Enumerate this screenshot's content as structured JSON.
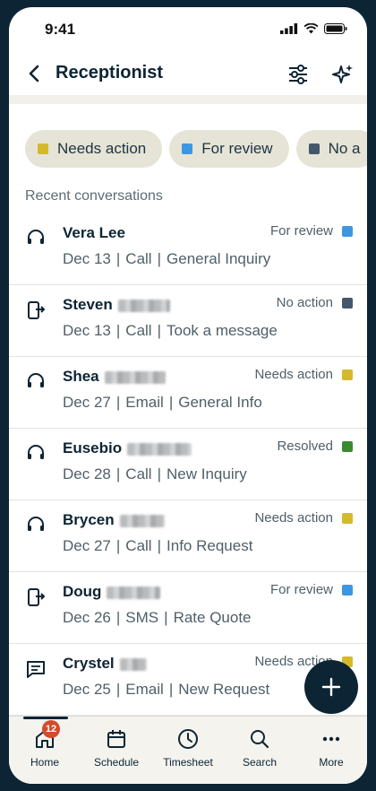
{
  "status_bar": {
    "time": "9:41"
  },
  "header": {
    "title": "Receptionist",
    "back_icon": "chevron-left-icon",
    "filter_icon": "sliders-icon",
    "ai_icon": "sparkles-icon"
  },
  "filters": [
    {
      "label": "Needs action",
      "color": "#d4b92c"
    },
    {
      "label": "For review",
      "color": "#3d96e0"
    },
    {
      "label": "No a",
      "color": "#45586a"
    }
  ],
  "section_title": "Recent conversations",
  "conversations": [
    {
      "name": "Vera Lee",
      "redacted": false,
      "date": "Dec 13",
      "channel": "Call",
      "topic": "General Inquiry",
      "status": "For review",
      "status_color": "#3d96e0",
      "icon": "headset-icon"
    },
    {
      "name": "Steven",
      "redacted": true,
      "date": "Dec 13",
      "channel": "Call",
      "topic": "Took a message",
      "status": "No action",
      "status_color": "#45586a",
      "icon": "phone-transfer-icon"
    },
    {
      "name": "Shea",
      "redacted": true,
      "date": "Dec 27",
      "channel": "Email",
      "topic": "General Info",
      "status": "Needs action",
      "status_color": "#d4b92c",
      "icon": "headset-icon"
    },
    {
      "name": "Eusebio",
      "redacted": true,
      "date": "Dec 28",
      "channel": "Call",
      "topic": "New Inquiry",
      "status": "Resolved",
      "status_color": "#3a8a32",
      "icon": "headset-icon"
    },
    {
      "name": "Brycen",
      "redacted": true,
      "date": "Dec 27",
      "channel": "Call",
      "topic": "Info Request",
      "status": "Needs action",
      "status_color": "#d4b92c",
      "icon": "headset-icon"
    },
    {
      "name": "Doug",
      "redacted": true,
      "date": "Dec 26",
      "channel": "SMS",
      "topic": "Rate Quote",
      "status": "For review",
      "status_color": "#3d96e0",
      "icon": "phone-transfer-icon"
    },
    {
      "name": "Crystel",
      "redacted": true,
      "date": "Dec 25",
      "channel": "Email",
      "topic": "New Request",
      "status": "Needs action",
      "status_color": "#d4b92c",
      "icon": "message-icon"
    }
  ],
  "fab": {
    "icon": "plus-icon"
  },
  "tabbar": {
    "tabs": [
      {
        "label": "Home",
        "icon": "home-icon",
        "badge": "12"
      },
      {
        "label": "Schedule",
        "icon": "calendar-icon"
      },
      {
        "label": "Timesheet",
        "icon": "clock-icon"
      },
      {
        "label": "Search",
        "icon": "search-icon"
      },
      {
        "label": "More",
        "icon": "more-icon"
      }
    ]
  }
}
